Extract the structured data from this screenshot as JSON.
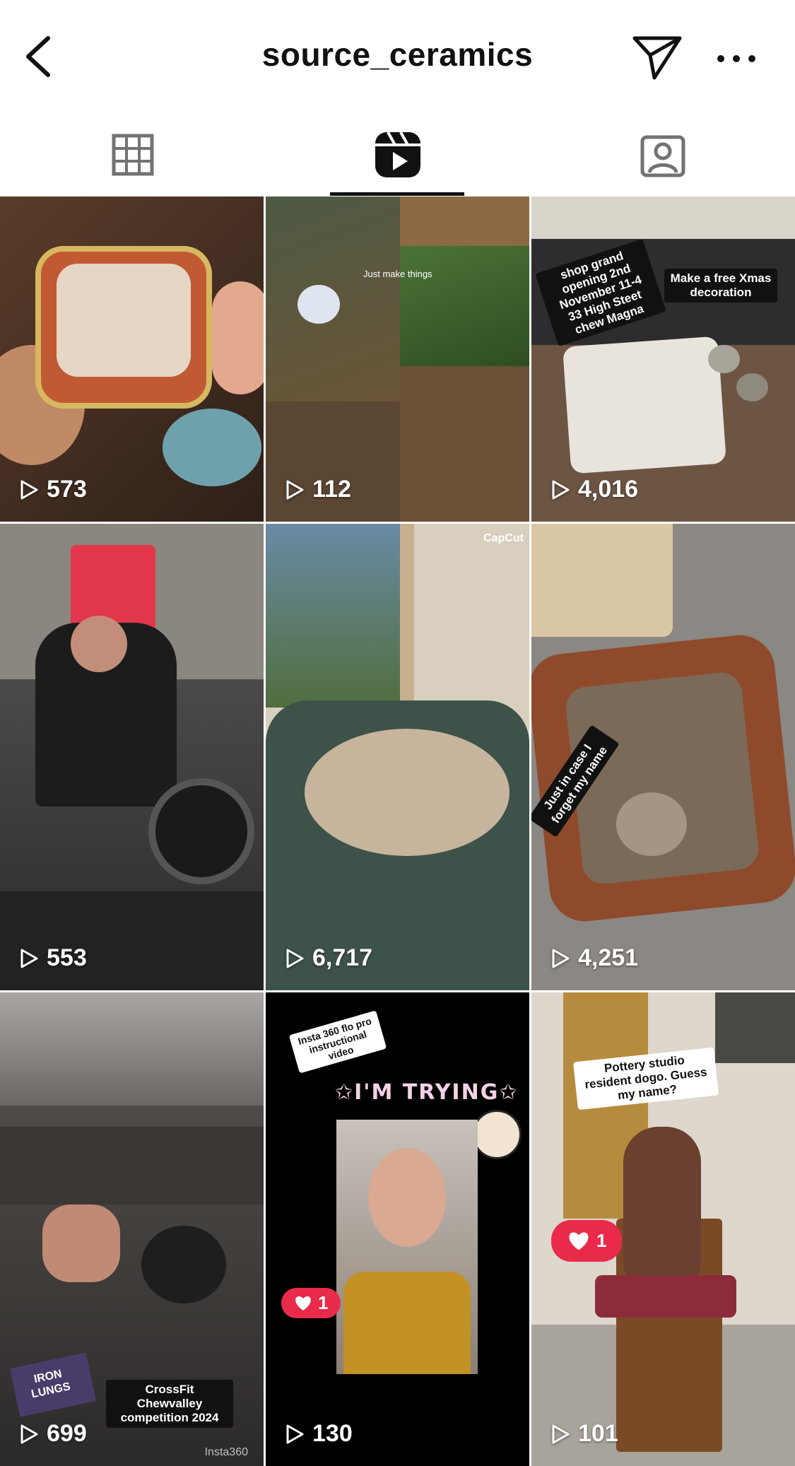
{
  "header": {
    "title": "source_ceramics",
    "back_icon": "chevron-left-icon",
    "send_icon": "paper-plane-icon",
    "more_icon": "more-horizontal-icon"
  },
  "tabs": [
    {
      "name": "posts-grid",
      "icon": "grid-icon",
      "active": false
    },
    {
      "name": "reels",
      "icon": "reels-icon",
      "active": true
    },
    {
      "name": "tagged",
      "icon": "tagged-person-icon",
      "active": false
    }
  ],
  "reels": [
    {
      "views": "573",
      "overlay": ""
    },
    {
      "views": "112",
      "overlay": "Just make things"
    },
    {
      "views": "4,016",
      "overlay_left": "shop grand opening 2nd November 11-4 33 High Steet chew Magna",
      "overlay_right": "Make a free Xmas decoration"
    },
    {
      "views": "553",
      "overlay": ""
    },
    {
      "views": "6,717",
      "watermark": "CapCut"
    },
    {
      "views": "4,251",
      "overlay": "Just in case I forget my name"
    },
    {
      "views": "699",
      "overlay": "CrossFit Chewvalley competition 2024",
      "brand": "IRON LUNGS",
      "watermark": "Insta360"
    },
    {
      "views": "130",
      "overlay_top": "Insta 360 flo pro instructional video",
      "title": "✩I'M TRYING✩",
      "likes": "1"
    },
    {
      "views": "101",
      "overlay": "Pottery studio resident dogo. Guess my name?",
      "likes": "1"
    }
  ],
  "colors": {
    "like_badge": "#ea2a4a",
    "text": "#111111",
    "icon_gray": "#737373"
  }
}
